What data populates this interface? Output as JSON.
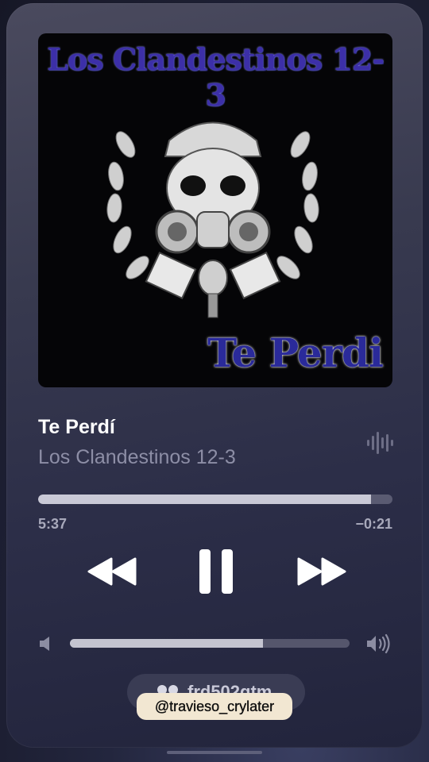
{
  "artwork": {
    "band_text": "Los Clandestinos 12-3",
    "song_text": "Te Perdi"
  },
  "track": {
    "title": "Te Perdí",
    "artist": "Los Clandestinos 12-3"
  },
  "playback": {
    "elapsed": "5:37",
    "remaining": "−0:21",
    "progress_fraction": 0.94,
    "state": "playing"
  },
  "volume": {
    "level_fraction": 0.69
  },
  "airplay": {
    "device_label": "frd502gtm",
    "icon": "airpods-icon"
  },
  "watermark": {
    "text": "@travieso_crylater"
  },
  "colors": {
    "accent_text": "#ffffff",
    "secondary_text": "#8d8ea6",
    "progress_fill": "#c9c9d6"
  }
}
